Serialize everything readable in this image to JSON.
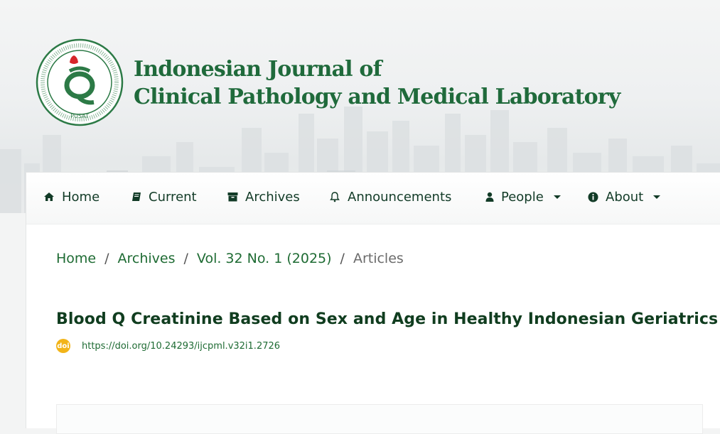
{
  "header": {
    "title_line1": "Indonesian Journal of",
    "title_line2": "Clinical Pathology  and Medical Laboratory",
    "logo": {
      "inner_text": "PUSAT"
    }
  },
  "nav": {
    "items": [
      {
        "label": "Home",
        "icon": "home-icon"
      },
      {
        "label": "Current",
        "icon": "book-icon"
      },
      {
        "label": "Archives",
        "icon": "archive-icon"
      },
      {
        "label": "Announcements",
        "icon": "bell-icon"
      },
      {
        "label": "People",
        "icon": "user-icon",
        "dropdown": true
      },
      {
        "label": "About",
        "icon": "info-icon",
        "dropdown": true
      }
    ]
  },
  "breadcrumb": {
    "items": [
      "Home",
      "Archives",
      "Vol. 32 No. 1 (2025)"
    ],
    "current": "Articles",
    "separator": "/"
  },
  "article": {
    "title": "Blood Q Creatinine Based on Sex and Age in Healthy Indonesian Geriatrics",
    "doi_badge": "doi",
    "doi_url": "https://doi.org/10.24293/ijcpml.v32i1.2726"
  },
  "colors": {
    "brand_green": "#1f6a3b",
    "nav_text": "#123b27",
    "link_green": "#1e6b33",
    "doi_badge": "#f2b418"
  }
}
